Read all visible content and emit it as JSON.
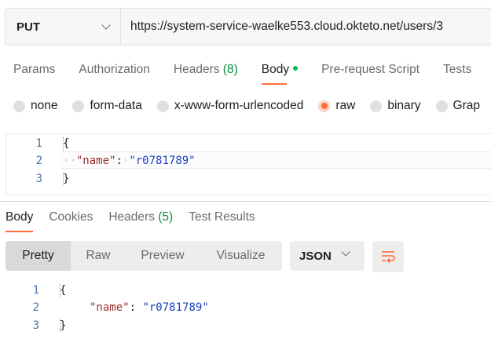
{
  "request": {
    "method": "PUT",
    "url": "https://system-service-waelke553.cloud.okteto.net/users/3"
  },
  "request_tabs": [
    {
      "label": "Params",
      "count": ""
    },
    {
      "label": "Authorization",
      "count": ""
    },
    {
      "label": "Headers",
      "count": "(8)"
    },
    {
      "label": "Body",
      "count": ""
    },
    {
      "label": "Pre-request Script",
      "count": ""
    },
    {
      "label": "Tests",
      "count": ""
    }
  ],
  "body_types": [
    "none",
    "form-data",
    "x-www-form-urlencoded",
    "raw",
    "binary",
    "Grap"
  ],
  "body_type_selected": "raw",
  "request_body": {
    "line_numbers": [
      "1",
      "2",
      "3"
    ],
    "open_brace": "{",
    "key": "\"name\"",
    "colon": ":",
    "value": "\"r0781789\"",
    "close_brace": "}"
  },
  "response_tabs": [
    {
      "label": "Body",
      "count": ""
    },
    {
      "label": "Cookies",
      "count": ""
    },
    {
      "label": "Headers",
      "count": "(5)"
    },
    {
      "label": "Test Results",
      "count": ""
    }
  ],
  "view_modes": [
    "Pretty",
    "Raw",
    "Preview",
    "Visualize"
  ],
  "format": "JSON",
  "response_body": {
    "line_numbers": [
      "1",
      "2",
      "3"
    ],
    "open_brace": "{",
    "key": "\"name\"",
    "colon": ":",
    "value": "\"r0781789\"",
    "close_brace": "}"
  },
  "icons": {
    "method_dropdown": "chevron-down-icon",
    "format_dropdown": "chevron-down-icon",
    "wrap": "wrap-lines-icon",
    "body_dot": "status-dot-icon"
  },
  "colors": {
    "accent": "#ff6c37",
    "count": "#0a8f3c",
    "dot": "#0cbb52",
    "json_key": "#9c2f2f",
    "json_string": "#1a3fbf"
  }
}
